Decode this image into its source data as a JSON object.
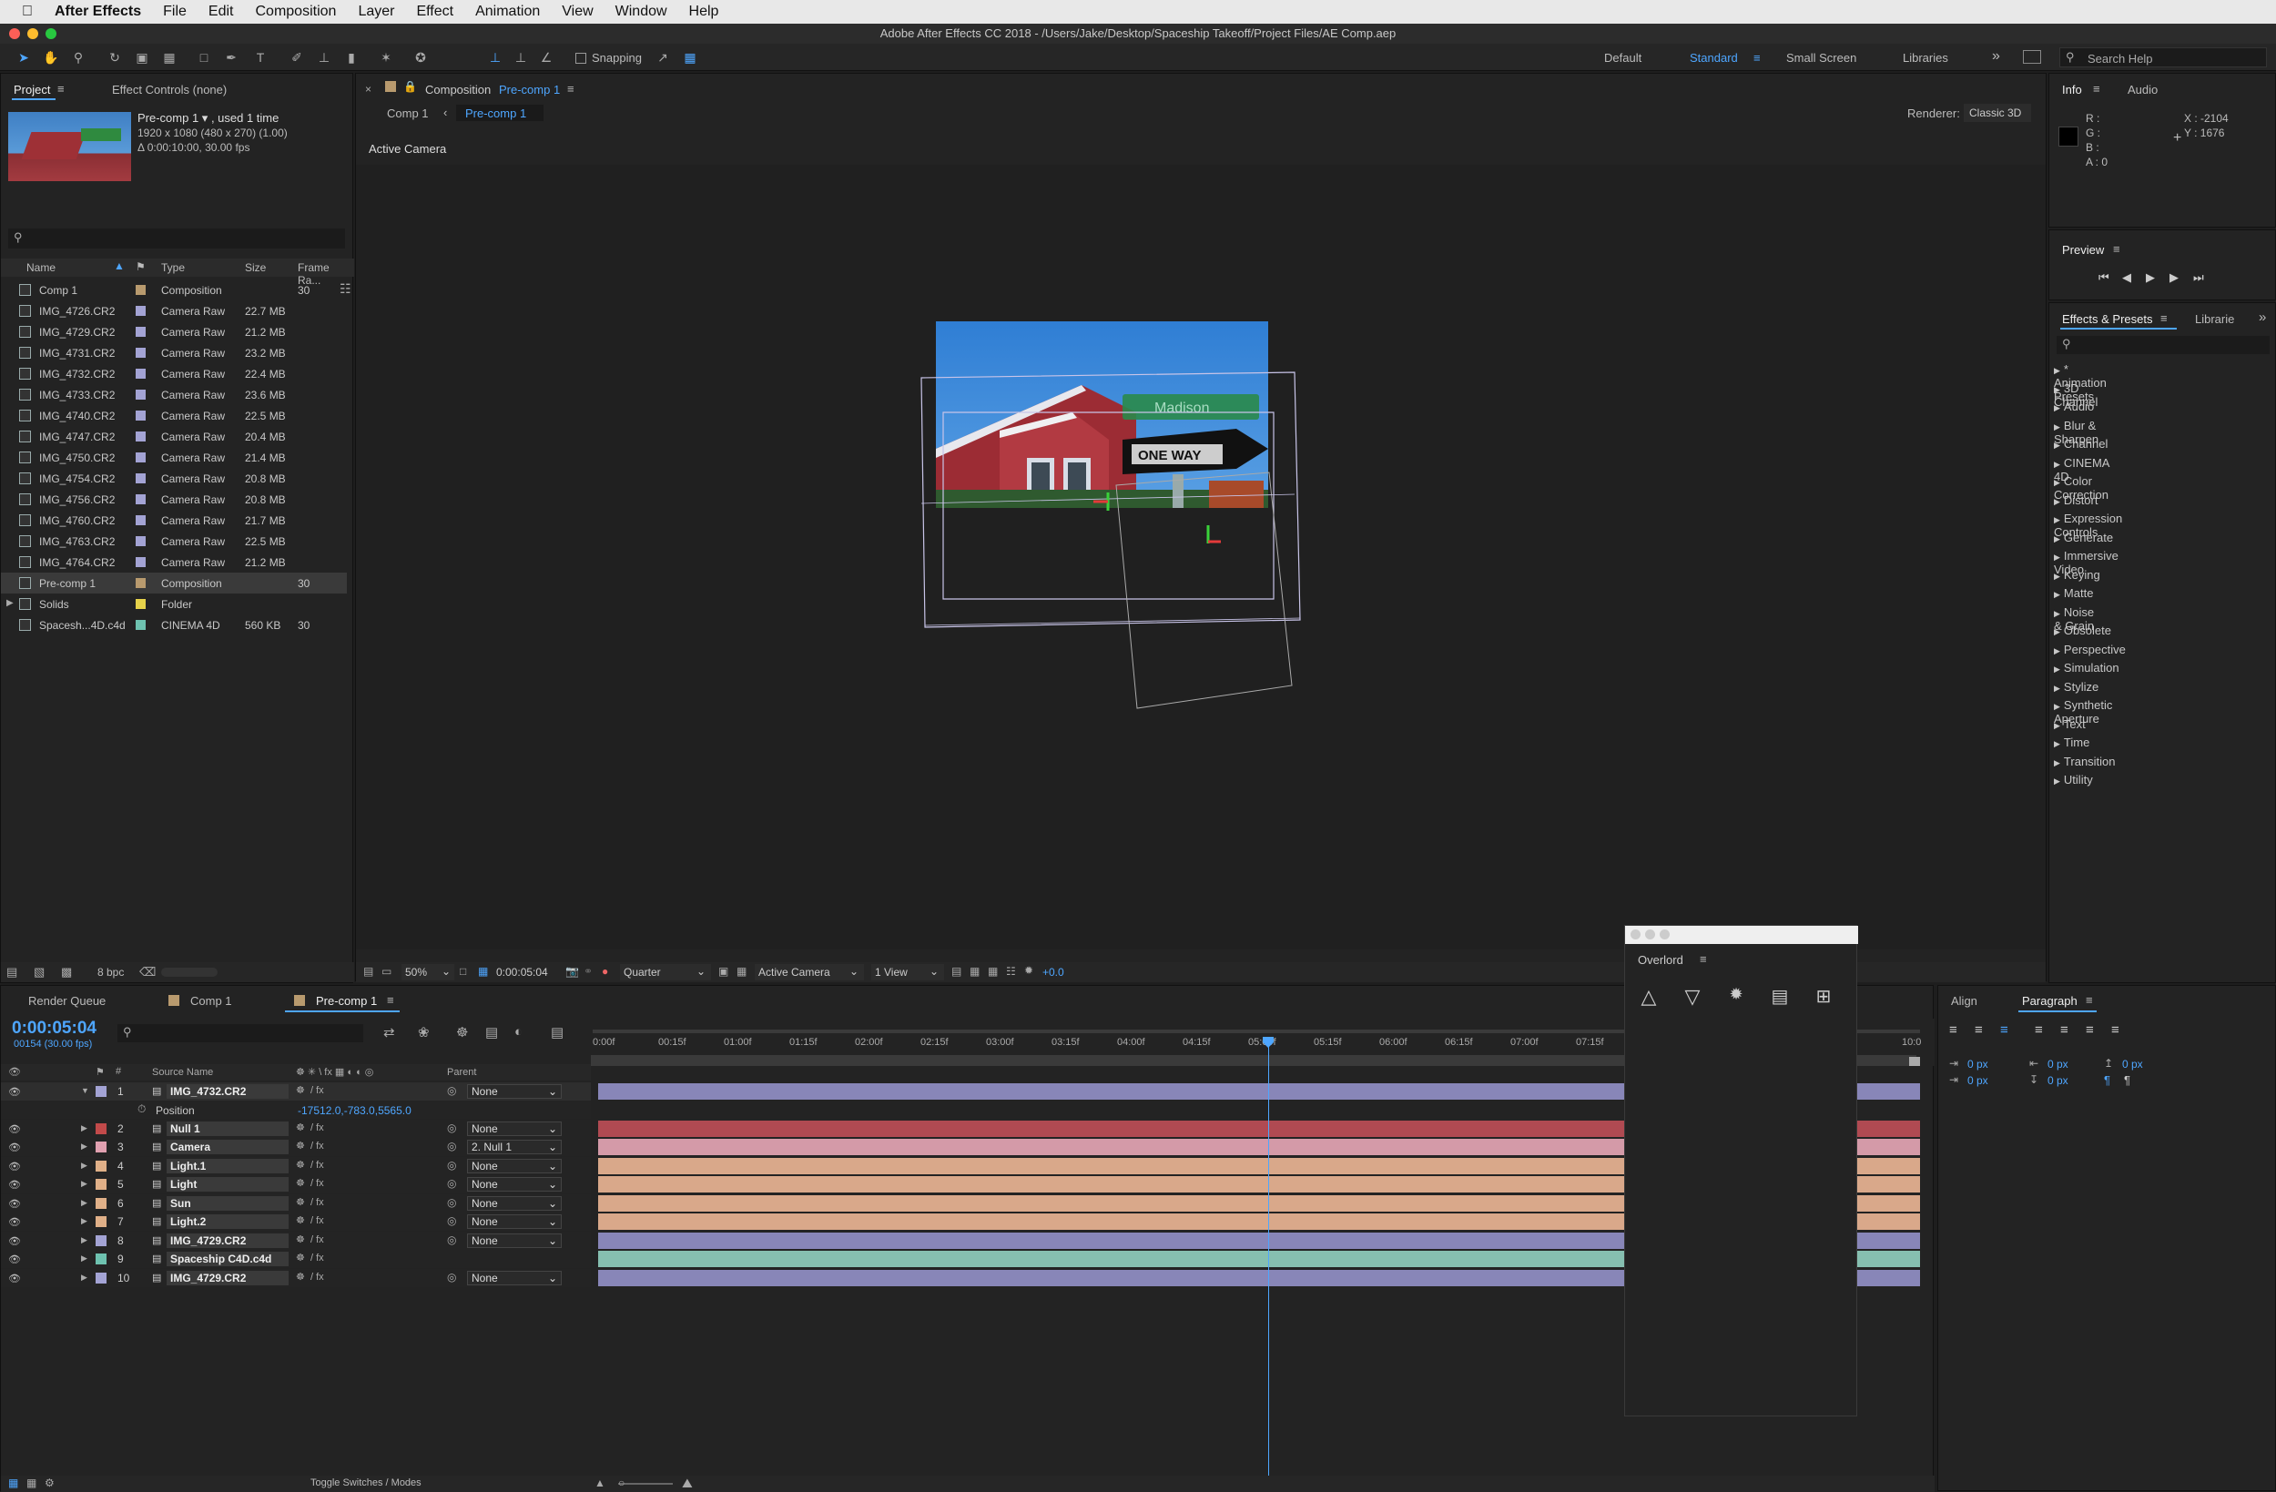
{
  "menubar": {
    "app": "After Effects",
    "items": [
      "File",
      "Edit",
      "Composition",
      "Layer",
      "Effect",
      "Animation",
      "View",
      "Window",
      "Help"
    ]
  },
  "window_title": "Adobe After Effects CC 2018 - /Users/Jake/Desktop/Spaceship Takeoff/Project Files/AE Comp.aep",
  "toolbar": {
    "snapping": "Snapping",
    "workspaces": [
      "Default",
      "Standard",
      "Small Screen",
      "Libraries"
    ],
    "active_workspace": "Standard",
    "search_placeholder": "Search Help"
  },
  "project_panel": {
    "tab_project": "Project",
    "tab_effect_controls": "Effect Controls (none)",
    "thumb_name": "Pre-comp 1 ▾ , used 1 time",
    "thumb_line2": "1920 x 1080  (480 x 270) (1.00)",
    "thumb_line3": "Δ 0:00:10:00, 30.00 fps",
    "columns": {
      "name": "Name",
      "type": "Type",
      "size": "Size",
      "frame": "Frame Ra..."
    },
    "items": [
      {
        "name": "Comp 1",
        "type": "Composition",
        "size": "",
        "fr": "30",
        "color": "#b89a6e"
      },
      {
        "name": "IMG_4726.CR2",
        "type": "Camera Raw",
        "size": "22.7 MB",
        "fr": "",
        "color": "#a3a3d4"
      },
      {
        "name": "IMG_4729.CR2",
        "type": "Camera Raw",
        "size": "21.2 MB",
        "fr": "",
        "color": "#a3a3d4"
      },
      {
        "name": "IMG_4731.CR2",
        "type": "Camera Raw",
        "size": "23.2 MB",
        "fr": "",
        "color": "#a3a3d4"
      },
      {
        "name": "IMG_4732.CR2",
        "type": "Camera Raw",
        "size": "22.4 MB",
        "fr": "",
        "color": "#a3a3d4"
      },
      {
        "name": "IMG_4733.CR2",
        "type": "Camera Raw",
        "size": "23.6 MB",
        "fr": "",
        "color": "#a3a3d4"
      },
      {
        "name": "IMG_4740.CR2",
        "type": "Camera Raw",
        "size": "22.5 MB",
        "fr": "",
        "color": "#a3a3d4"
      },
      {
        "name": "IMG_4747.CR2",
        "type": "Camera Raw",
        "size": "20.4 MB",
        "fr": "",
        "color": "#a3a3d4"
      },
      {
        "name": "IMG_4750.CR2",
        "type": "Camera Raw",
        "size": "21.4 MB",
        "fr": "",
        "color": "#a3a3d4"
      },
      {
        "name": "IMG_4754.CR2",
        "type": "Camera Raw",
        "size": "20.8 MB",
        "fr": "",
        "color": "#a3a3d4"
      },
      {
        "name": "IMG_4756.CR2",
        "type": "Camera Raw",
        "size": "20.8 MB",
        "fr": "",
        "color": "#a3a3d4"
      },
      {
        "name": "IMG_4760.CR2",
        "type": "Camera Raw",
        "size": "21.7 MB",
        "fr": "",
        "color": "#a3a3d4"
      },
      {
        "name": "IMG_4763.CR2",
        "type": "Camera Raw",
        "size": "22.5 MB",
        "fr": "",
        "color": "#a3a3d4"
      },
      {
        "name": "IMG_4764.CR2",
        "type": "Camera Raw",
        "size": "21.2 MB",
        "fr": "",
        "color": "#a3a3d4"
      },
      {
        "name": "Pre-comp 1",
        "type": "Composition",
        "size": "",
        "fr": "30",
        "color": "#b89a6e"
      },
      {
        "name": "Solids",
        "type": "Folder",
        "size": "",
        "fr": "",
        "color": "#e6d24a"
      },
      {
        "name": "Spacesh...4D.c4d",
        "type": "CINEMA 4D",
        "size": "560 KB",
        "fr": "30",
        "color": "#6ec2b0"
      }
    ],
    "bpc": "8 bpc"
  },
  "comp_panel": {
    "tab": "Composition",
    "tab_name": "Pre-comp 1",
    "breadcrumb": [
      "Comp 1",
      "Pre-comp 1"
    ],
    "renderer_label": "Renderer:",
    "renderer": "Classic 3D",
    "view_label": "Active Camera",
    "zoom": "50%",
    "timecode": "0:00:05:04",
    "resolution": "Quarter",
    "camera": "Active Camera",
    "views": "1 View",
    "exposure": "+0.0"
  },
  "info_panel": {
    "tab_info": "Info",
    "tab_audio": "Audio",
    "r": "R :",
    "g": "G :",
    "b": "B :",
    "a": "A :  0",
    "x": "X : -2104",
    "y": "Y :  1676"
  },
  "preview_panel": {
    "title": "Preview"
  },
  "effects_panel": {
    "tab": "Effects & Presets",
    "tab2": "Librarie",
    "items": [
      "* Animation Presets",
      "3D Channel",
      "Audio",
      "Blur & Sharpen",
      "Channel",
      "CINEMA 4D",
      "Color Correction",
      "Distort",
      "Expression Controls",
      "Generate",
      "Immersive Video",
      "Keying",
      "Matte",
      "Noise & Grain",
      "Obsolete",
      "Perspective",
      "Simulation",
      "Stylize",
      "Synthetic Aperture",
      "Text",
      "Time",
      "Transition",
      "Utility"
    ]
  },
  "timeline": {
    "tabs": [
      "Render Queue",
      "Comp 1",
      "Pre-comp 1"
    ],
    "timecode": "0:00:05:04",
    "frames": "00154 (30.00 fps)",
    "col_source": "Source Name",
    "col_parent": "Parent",
    "ruler": [
      "0:00f",
      "00:15f",
      "01:00f",
      "01:15f",
      "02:00f",
      "02:15f",
      "03:00f",
      "03:15f",
      "04:00f",
      "04:15f",
      "05:00f",
      "05:15f",
      "06:00f",
      "06:15f",
      "07:00f",
      "07:15f",
      "10:0"
    ],
    "position_label": "Position",
    "position_value": "-17512.0,-783.0,5565.0",
    "layers": [
      {
        "num": "1",
        "name": "IMG_4732.CR2",
        "parent": "None",
        "color": "#a3a3d4",
        "bar": "#8886b8"
      },
      {
        "num": "2",
        "name": "Null 1",
        "parent": "None",
        "color": "#c24a4a",
        "bar": "#b04a52"
      },
      {
        "num": "3",
        "name": "Camera",
        "parent": "2. Null 1",
        "color": "#e0a0b0",
        "bar": "#d49aa8"
      },
      {
        "num": "4",
        "name": "Light.1",
        "parent": "None",
        "color": "#e0b088",
        "bar": "#d9a88a"
      },
      {
        "num": "5",
        "name": "Light",
        "parent": "None",
        "color": "#e0b088",
        "bar": "#d9a88a"
      },
      {
        "num": "6",
        "name": "Sun",
        "parent": "None",
        "color": "#e0b088",
        "bar": "#d9a88a"
      },
      {
        "num": "7",
        "name": "Light.2",
        "parent": "None",
        "color": "#e0b088",
        "bar": "#d9a88a"
      },
      {
        "num": "8",
        "name": "IMG_4729.CR2",
        "parent": "None",
        "color": "#a3a3d4",
        "bar": "#8886b8"
      },
      {
        "num": "9",
        "name": "Spaceship C4D.c4d",
        "parent": "",
        "color": "#6ec2b0",
        "bar": "#86bfb0"
      },
      {
        "num": "10",
        "name": "IMG_4729.CR2",
        "parent": "None",
        "color": "#a3a3d4",
        "bar": "#8886b8"
      }
    ],
    "toggle": "Toggle Switches / Modes"
  },
  "overlord": {
    "title": "Overlord"
  },
  "align_panel": {
    "tab_align": "Align",
    "tab_paragraph": "Paragraph",
    "values": [
      "0 px",
      "0 px",
      "0 px",
      "0 px",
      "0 px"
    ]
  },
  "image_text": {
    "sign1": "Madison",
    "sign2": "ONE WAY"
  }
}
